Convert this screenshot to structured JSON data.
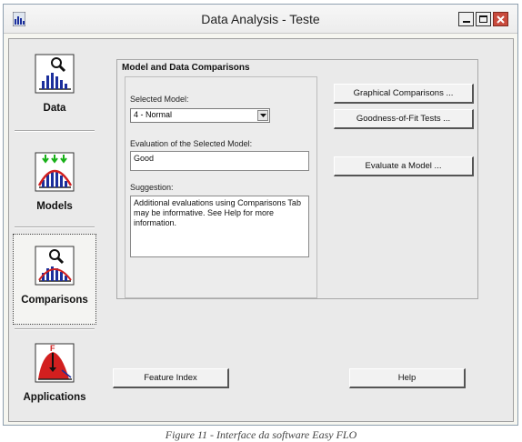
{
  "window": {
    "title": "Data Analysis - Teste"
  },
  "nav": {
    "items": [
      {
        "label": "Data",
        "icon": "data-chart-magnifier-icon"
      },
      {
        "label": "Models",
        "icon": "models-bell-curve-icon"
      },
      {
        "label": "Comparisons",
        "icon": "comparisons-chart-magnifier-icon"
      },
      {
        "label": "Applications",
        "icon": "applications-curve-icon"
      }
    ],
    "selected": "Comparisons"
  },
  "panel": {
    "title": "Model and Data Comparisons",
    "selected_model_label": "Selected Model:",
    "selected_model_value": "4 - Normal",
    "evaluation_label": "Evaluation of the Selected Model:",
    "evaluation_value": "Good",
    "suggestion_label": "Suggestion:",
    "suggestion_value": "Additional evaluations using Comparisons Tab may be informative. See Help for more information."
  },
  "buttons": {
    "graphical_comparisons": "Graphical Comparisons ...",
    "goodness_of_fit": "Goodness-of-Fit Tests ...",
    "evaluate_model": "Evaluate a Model ...",
    "feature_index": "Feature Index",
    "help": "Help"
  },
  "caption": "Figure 11 - Interface da software Easy FLO",
  "colors": {
    "close_button": "#c94a3c",
    "icon_blue": "#1c2f9c",
    "icon_red": "#d21f1f",
    "icon_green": "#18b018"
  }
}
